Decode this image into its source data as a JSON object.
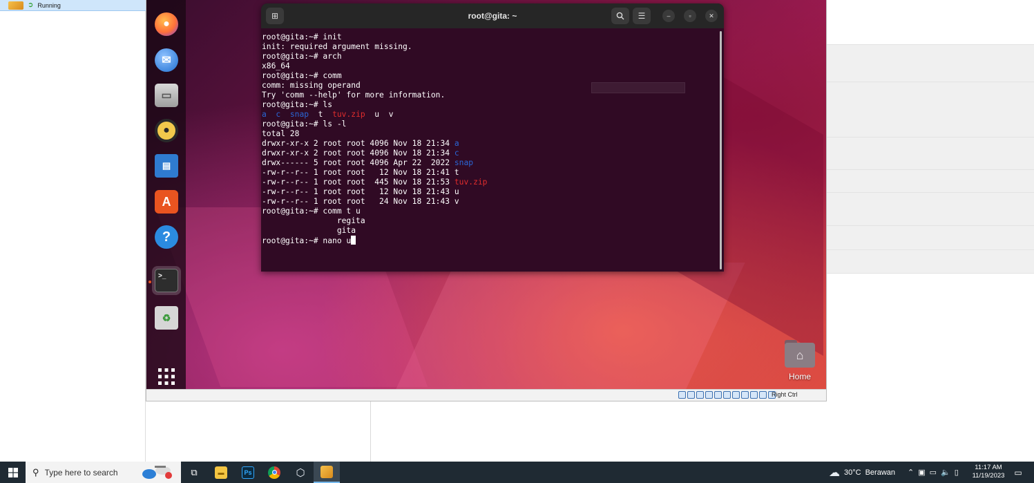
{
  "host": {
    "vm_status_label": "Running"
  },
  "terminal": {
    "title": "root@gita: ~",
    "lines": [
      [
        {
          "t": "root@gita:~# init"
        }
      ],
      [
        {
          "t": "init: required argument missing."
        }
      ],
      [
        {
          "t": "root@gita:~# arch"
        }
      ],
      [
        {
          "t": "x86_64"
        }
      ],
      [
        {
          "t": "root@gita:~# comm"
        }
      ],
      [
        {
          "t": "comm: missing operand"
        }
      ],
      [
        {
          "t": "Try 'comm --help' for more information."
        }
      ],
      [
        {
          "t": "root@gita:~# ls"
        }
      ],
      [
        {
          "t": "a",
          "c": "blue"
        },
        {
          "t": "  "
        },
        {
          "t": "c",
          "c": "blue"
        },
        {
          "t": "  "
        },
        {
          "t": "snap",
          "c": "blue"
        },
        {
          "t": "  t  "
        },
        {
          "t": "tuv.zip",
          "c": "red"
        },
        {
          "t": "  u  v"
        }
      ],
      [
        {
          "t": "root@gita:~# ls -l"
        }
      ],
      [
        {
          "t": "total 28"
        }
      ],
      [
        {
          "t": "drwxr-xr-x 2 root root 4096 Nov 18 21:34 "
        },
        {
          "t": "a",
          "c": "blue"
        }
      ],
      [
        {
          "t": "drwxr-xr-x 2 root root 4096 Nov 18 21:34 "
        },
        {
          "t": "c",
          "c": "blue"
        }
      ],
      [
        {
          "t": "drwx------ 5 root root 4096 Apr 22  2022 "
        },
        {
          "t": "snap",
          "c": "blue"
        }
      ],
      [
        {
          "t": "-rw-r--r-- 1 root root   12 Nov 18 21:41 t"
        }
      ],
      [
        {
          "t": "-rw-r--r-- 1 root root  445 Nov 18 21:53 "
        },
        {
          "t": "tuv.zip",
          "c": "red"
        }
      ],
      [
        {
          "t": "-rw-r--r-- 1 root root   12 Nov 18 21:43 u"
        }
      ],
      [
        {
          "t": "-rw-r--r-- 1 root root   24 Nov 18 21:43 v"
        }
      ],
      [
        {
          "t": "root@gita:~# comm t u"
        }
      ],
      [
        {
          "t": "                regita"
        }
      ],
      [
        {
          "t": "                gita"
        }
      ],
      [
        {
          "t": "root@gita:~# nano u"
        },
        {
          "cursor": true
        }
      ]
    ]
  },
  "desktop": {
    "home_label": "Home"
  },
  "vm_statusbar": {
    "host_key_label": "Right Ctrl"
  },
  "taskbar": {
    "search_placeholder": "Type here to search",
    "apps": [
      {
        "name": "task-view",
        "icon": "task-view-icon"
      },
      {
        "name": "file-explorer",
        "icon": "folder-icon"
      },
      {
        "name": "photoshop",
        "icon": "photoshop-icon"
      },
      {
        "name": "chrome",
        "icon": "chrome-icon"
      },
      {
        "name": "virtualbox",
        "icon": "virtualbox-icon"
      },
      {
        "name": "virtualbox-vm",
        "icon": "vm-window-icon"
      }
    ],
    "weather_temp": "30°C",
    "weather_desc": "Berawan",
    "clock_time": "11:17 AM",
    "clock_date": "11/19/2023"
  },
  "colors": {
    "terminal_bg": "#300a24",
    "ls_dir": "#2a66d6",
    "ls_archive": "#e22d2d",
    "taskbar_bg": "#1f2a33"
  }
}
